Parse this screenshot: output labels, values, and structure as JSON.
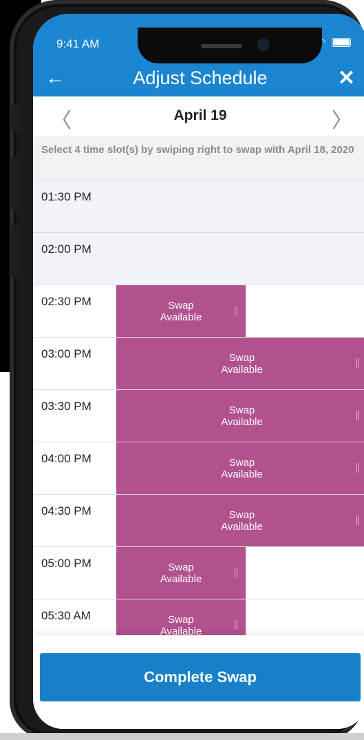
{
  "status_bar": {
    "time": "9:41 AM"
  },
  "app_bar": {
    "back_icon": "arrow-left-icon",
    "title": "Adjust Schedule",
    "close_icon": "close-icon"
  },
  "date_nav": {
    "prev_icon": "chevron-left-icon",
    "date": "April 19",
    "next_icon": "chevron-right-icon"
  },
  "instruction": "Select 4 time slot(s) by swiping right to swap with April 18, 2020",
  "slot_label_line1": "Swap",
  "slot_label_line2": "Available",
  "rows": [
    {
      "time": "01:30 PM",
      "slot": "none"
    },
    {
      "time": "02:00 PM",
      "slot": "none"
    },
    {
      "time": "02:30 PM",
      "slot": "short"
    },
    {
      "time": "03:00 PM",
      "slot": "long"
    },
    {
      "time": "03:30 PM",
      "slot": "long"
    },
    {
      "time": "04:00 PM",
      "slot": "long"
    },
    {
      "time": "04:30 PM",
      "slot": "long"
    },
    {
      "time": "05:00 PM",
      "slot": "short"
    },
    {
      "time": "05:30 AM",
      "slot": "short"
    }
  ],
  "footer": {
    "button_label": "Complete Swap"
  },
  "colors": {
    "primary": "#1b85d1",
    "slot": "#b1518d",
    "button": "#1880c8"
  }
}
